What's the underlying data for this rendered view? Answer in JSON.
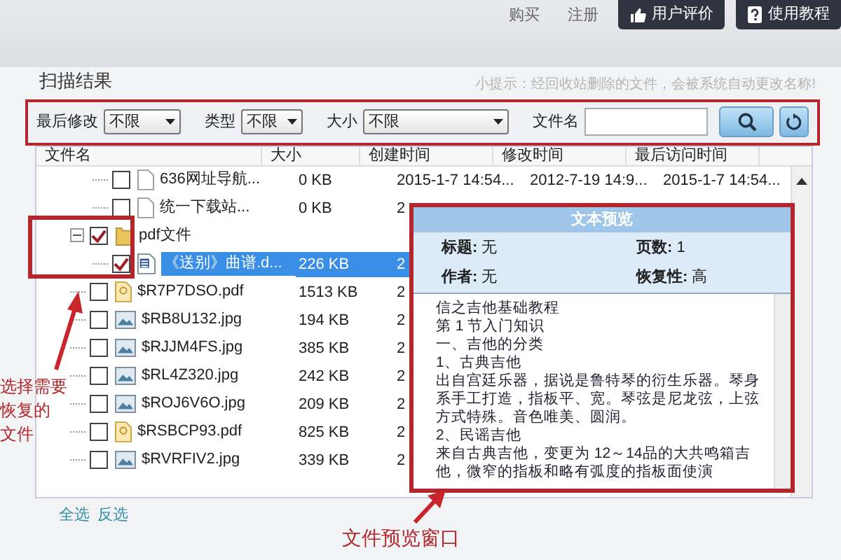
{
  "top_bar": {
    "links": [
      "购买",
      "注册"
    ],
    "buttons": [
      {
        "label": "用户评价",
        "kind": "rating"
      },
      {
        "label": "使用教程",
        "kind": "help"
      }
    ]
  },
  "section_title": "扫描结果",
  "hint": "小提示：经回收站删除的文件，会被系统自动更改名称!",
  "filters": [
    {
      "label": "最后修改",
      "value": "不限",
      "kind": "date"
    },
    {
      "label": "类型",
      "value": "不限",
      "kind": "type"
    },
    {
      "label": "大小",
      "value": "不限",
      "kind": "size"
    }
  ],
  "filename_filter": {
    "label": "文件名"
  },
  "table": {
    "columns": [
      "文件名",
      "大小",
      "创建时间",
      "修改时间",
      "最后访问时间"
    ],
    "rows": [
      {
        "children": [
          {
            "name": "636网址导航...",
            "size": "0 KB",
            "created": "2015-1-7 14:54...",
            "modified": "2012-7-19 14:9...",
            "accessed": "2015-1-7 14:54...",
            "kind": "file",
            "checked": false,
            "selected": false
          },
          {
            "name": "统一下载站...",
            "size": "0 KB",
            "created": "2",
            "kind": "file",
            "checked": false,
            "selected": false
          }
        ]
      },
      {
        "name": "pdf文件",
        "kind": "folder",
        "checked": true,
        "selected": false,
        "expanded": true,
        "children": [
          {
            "name": "《送别》曲谱.d...",
            "size": "226 KB",
            "created": "2",
            "kind": "word",
            "checked": true,
            "selected": true
          }
        ]
      },
      {
        "name": "$R7P7DSO.pdf",
        "size": "1513 KB",
        "created": "2",
        "kind": "pdf",
        "checked": false,
        "selected": false
      },
      {
        "name": "$RB8U132.jpg",
        "size": "194 KB",
        "created": "2",
        "kind": "image",
        "checked": false,
        "selected": false
      },
      {
        "name": "$RJJM4FS.jpg",
        "size": "385 KB",
        "created": "2",
        "kind": "image",
        "checked": false,
        "selected": false
      },
      {
        "name": "$RL4Z320.jpg",
        "size": "242 KB",
        "created": "2",
        "kind": "image",
        "checked": false,
        "selected": false
      },
      {
        "name": "$ROJ6V6O.jpg",
        "size": "209 KB",
        "created": "2",
        "kind": "image",
        "checked": false,
        "selected": false
      },
      {
        "name": "$RSBCP93.pdf",
        "size": "825 KB",
        "created": "2",
        "kind": "pdf",
        "checked": false,
        "selected": false
      },
      {
        "name": "$RVRFIV2.jpg",
        "size": "339 KB",
        "created": "2",
        "kind": "image",
        "checked": false,
        "selected": false
      }
    ]
  },
  "selection_links": [
    "全选",
    "反选"
  ],
  "preview": {
    "title": "文本预览",
    "fields": [
      {
        "label": "标题:",
        "value": "无"
      },
      {
        "label": "页数:",
        "value": "1"
      },
      {
        "label": "作者:",
        "value": "无"
      },
      {
        "label": "恢复性:",
        "value": "高"
      }
    ],
    "lines": [
      "信之吉他基础教程",
      "第 1 节入门知识",
      "一、吉他的分类",
      "1、古典吉他",
      "出自宫廷乐器，据说是鲁特琴的衍生乐器。琴身系手工打造，指板平、宽。琴弦是尼龙弦，上弦方式特殊。音色唯美、圆润。",
      "2、民谣吉他",
      "来自古典吉他，变更为 12～14品的大共鸣箱吉他，微窄的指板和略有弧度的指板面使演"
    ]
  },
  "annotations": [
    {
      "kind": "side",
      "lines": [
        "选择需要",
        "恢复的",
        "文件"
      ]
    },
    {
      "kind": "bottom",
      "lines": [
        "文件预览窗口"
      ]
    }
  ]
}
